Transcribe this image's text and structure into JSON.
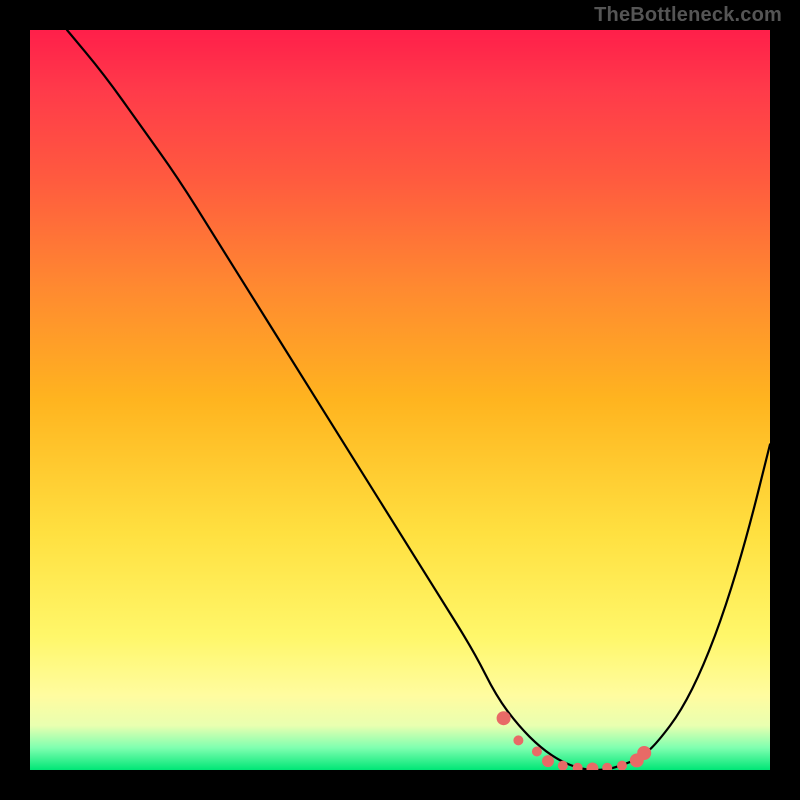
{
  "watermark": "TheBottleneck.com",
  "chart_data": {
    "type": "line",
    "title": "",
    "xlabel": "",
    "ylabel": "",
    "xlim": [
      0,
      100
    ],
    "ylim": [
      0,
      100
    ],
    "legend": false,
    "grid": false,
    "series": [
      {
        "name": "curve",
        "x": [
          5,
          10,
          15,
          20,
          25,
          30,
          35,
          40,
          45,
          50,
          55,
          60,
          63,
          66,
          69,
          72,
          75,
          78,
          81,
          83,
          85,
          88,
          91,
          94,
          97,
          100
        ],
        "values": [
          100,
          94,
          87,
          80,
          72,
          64,
          56,
          48,
          40,
          32,
          24,
          16,
          10,
          6,
          3,
          1,
          0,
          0,
          1,
          2,
          4,
          8,
          14,
          22,
          32,
          44
        ]
      }
    ],
    "highlight_points": {
      "name": "flat-zone-dots",
      "x": [
        64,
        66,
        68.5,
        70,
        72,
        74,
        76,
        78,
        80,
        82,
        83
      ],
      "values": [
        7,
        4,
        2.5,
        1.2,
        0.6,
        0.3,
        0.2,
        0.3,
        0.6,
        1.3,
        2.3
      ]
    },
    "gradient_stops": [
      {
        "pos": 0,
        "color": "#ff1f4a"
      },
      {
        "pos": 50,
        "color": "#ffb41f"
      },
      {
        "pos": 85,
        "color": "#fff76a"
      },
      {
        "pos": 100,
        "color": "#00e676"
      }
    ]
  }
}
